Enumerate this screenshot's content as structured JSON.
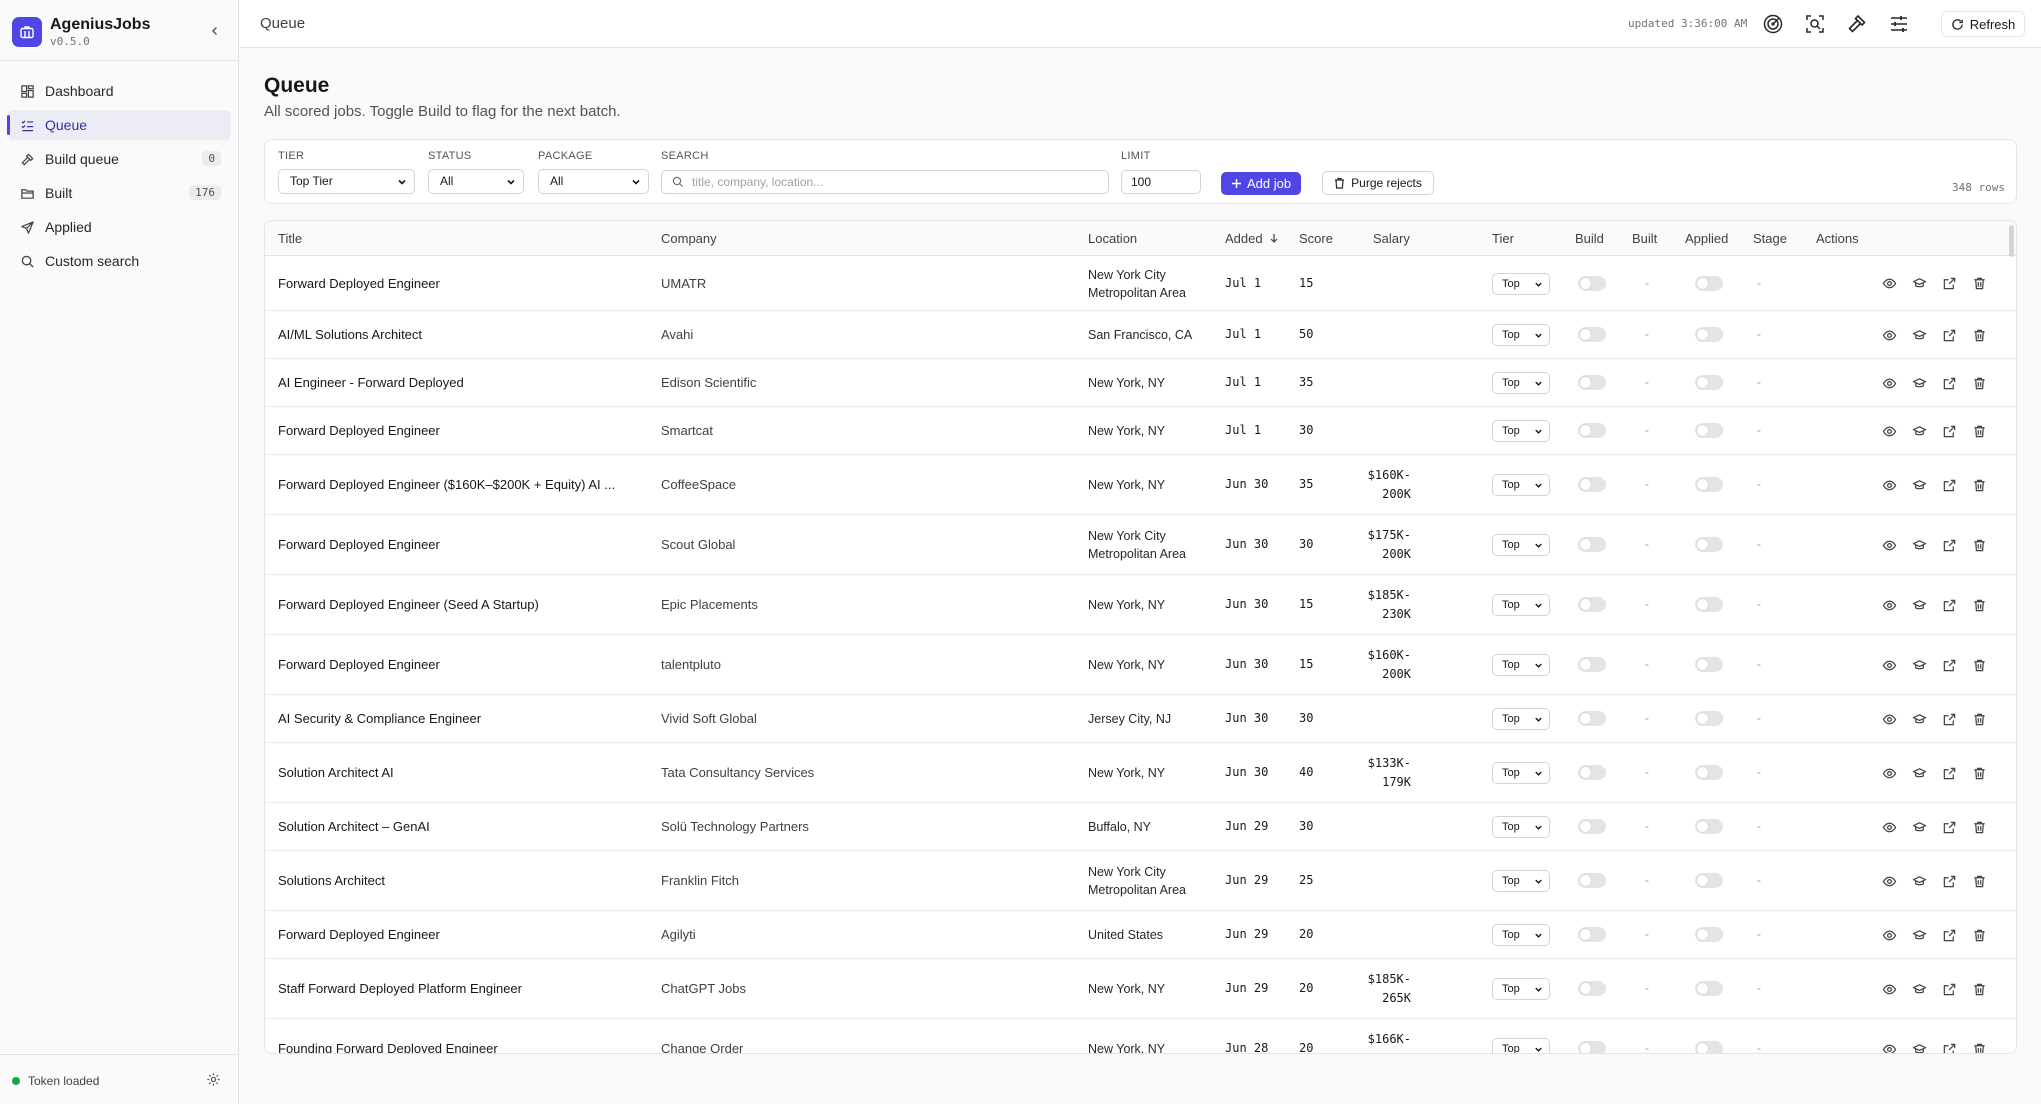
{
  "app": {
    "name": "AgeniusJobs",
    "version": "v0.5.0"
  },
  "nav": [
    {
      "label": "Dashboard",
      "icon": "dashboard-icon",
      "active": false,
      "badge": ""
    },
    {
      "label": "Queue",
      "icon": "queue-list-icon",
      "active": true,
      "badge": ""
    },
    {
      "label": "Build queue",
      "icon": "hammer-icon",
      "active": false,
      "badge": "0"
    },
    {
      "label": "Built",
      "icon": "folder-icon",
      "active": false,
      "badge": "176"
    },
    {
      "label": "Applied",
      "icon": "send-icon",
      "active": false,
      "badge": ""
    },
    {
      "label": "Custom search",
      "icon": "search-icon",
      "active": false,
      "badge": ""
    }
  ],
  "footer": {
    "token_status": "Token loaded"
  },
  "topbar": {
    "breadcrumb": "Queue",
    "updated": "updated 3:36:00 AM",
    "refresh_label": "Refresh"
  },
  "page": {
    "title": "Queue",
    "subtitle": "All scored jobs. Toggle Build to flag for the next batch."
  },
  "filters": {
    "tier_label": "TIER",
    "tier_value": "Top Tier",
    "status_label": "STATUS",
    "status_value": "All",
    "package_label": "PACKAGE",
    "package_value": "All",
    "search_label": "SEARCH",
    "search_placeholder": "title, company, location...",
    "limit_label": "LIMIT",
    "limit_value": "100",
    "add_label": "Add job",
    "purge_label": "Purge rejects",
    "row_count": "348 rows"
  },
  "table": {
    "columns": {
      "title": "Title",
      "company": "Company",
      "location": "Location",
      "added": "Added",
      "score": "Score",
      "salary": "Salary",
      "tier": "Tier",
      "build": "Build",
      "built": "Built",
      "applied": "Applied",
      "stage": "Stage",
      "actions": "Actions"
    },
    "rows": [
      {
        "title": "Forward Deployed Engineer",
        "company": "UMATR",
        "location": "New York City Metropolitan Area",
        "added": "Jul 1",
        "score": "15",
        "salary": "",
        "tier": "Top",
        "built": "-",
        "stage": "-"
      },
      {
        "title": "AI/ML Solutions Architect",
        "company": "Avahi",
        "location": "San Francisco, CA",
        "added": "Jul 1",
        "score": "50",
        "salary": "",
        "tier": "Top",
        "built": "-",
        "stage": "-"
      },
      {
        "title": "AI Engineer - Forward Deployed",
        "company": "Edison Scientific",
        "location": "New York, NY",
        "added": "Jul 1",
        "score": "35",
        "salary": "",
        "tier": "Top",
        "built": "-",
        "stage": "-"
      },
      {
        "title": "Forward Deployed Engineer",
        "company": "Smartcat",
        "location": "New York, NY",
        "added": "Jul 1",
        "score": "30",
        "salary": "",
        "tier": "Top",
        "built": "-",
        "stage": "-"
      },
      {
        "title": "Forward Deployed Engineer ($160K–$200K + Equity) AI ...",
        "company": "CoffeeSpace",
        "location": "New York, NY",
        "added": "Jun 30",
        "score": "35",
        "salary": "$160K-\n200K",
        "tier": "Top",
        "built": "-",
        "stage": "-"
      },
      {
        "title": "Forward Deployed Engineer",
        "company": "Scout Global",
        "location": "New York City Metropolitan Area",
        "added": "Jun 30",
        "score": "30",
        "salary": "$175K-\n200K",
        "tier": "Top",
        "built": "-",
        "stage": "-"
      },
      {
        "title": "Forward Deployed Engineer (Seed A Startup)",
        "company": "Epic Placements",
        "location": "New York, NY",
        "added": "Jun 30",
        "score": "15",
        "salary": "$185K-\n230K",
        "tier": "Top",
        "built": "-",
        "stage": "-"
      },
      {
        "title": "Forward Deployed Engineer",
        "company": "talentpluto",
        "location": "New York, NY",
        "added": "Jun 30",
        "score": "15",
        "salary": "$160K-\n200K",
        "tier": "Top",
        "built": "-",
        "stage": "-"
      },
      {
        "title": "AI Security & Compliance Engineer",
        "company": "Vivid Soft Global",
        "location": "Jersey City, NJ",
        "added": "Jun 30",
        "score": "30",
        "salary": "",
        "tier": "Top",
        "built": "-",
        "stage": "-"
      },
      {
        "title": "Solution Architect AI",
        "company": "Tata Consultancy Services",
        "location": "New York, NY",
        "added": "Jun 30",
        "score": "40",
        "salary": "$133K-\n179K",
        "tier": "Top",
        "built": "-",
        "stage": "-"
      },
      {
        "title": "Solution Architect – GenAI",
        "company": "Solü Technology Partners",
        "location": "Buffalo, NY",
        "added": "Jun 29",
        "score": "30",
        "salary": "",
        "tier": "Top",
        "built": "-",
        "stage": "-"
      },
      {
        "title": "Solutions Architect",
        "company": "Franklin Fitch",
        "location": "New York City Metropolitan Area",
        "added": "Jun 29",
        "score": "25",
        "salary": "",
        "tier": "Top",
        "built": "-",
        "stage": "-"
      },
      {
        "title": "Forward Deployed Engineer",
        "company": "Agilyti",
        "location": "United States",
        "added": "Jun 29",
        "score": "20",
        "salary": "",
        "tier": "Top",
        "built": "-",
        "stage": "-"
      },
      {
        "title": "Staff Forward Deployed Platform Engineer",
        "company": "ChatGPT Jobs",
        "location": "New York, NY",
        "added": "Jun 29",
        "score": "20",
        "salary": "$185K-\n265K",
        "tier": "Top",
        "built": "-",
        "stage": "-"
      },
      {
        "title": "Founding Forward Deployed Engineer",
        "company": "Change Order",
        "location": "New York, NY",
        "added": "Jun 28",
        "score": "20",
        "salary": "$166K-\n",
        "tier": "Top",
        "built": "-",
        "stage": "-"
      }
    ]
  }
}
